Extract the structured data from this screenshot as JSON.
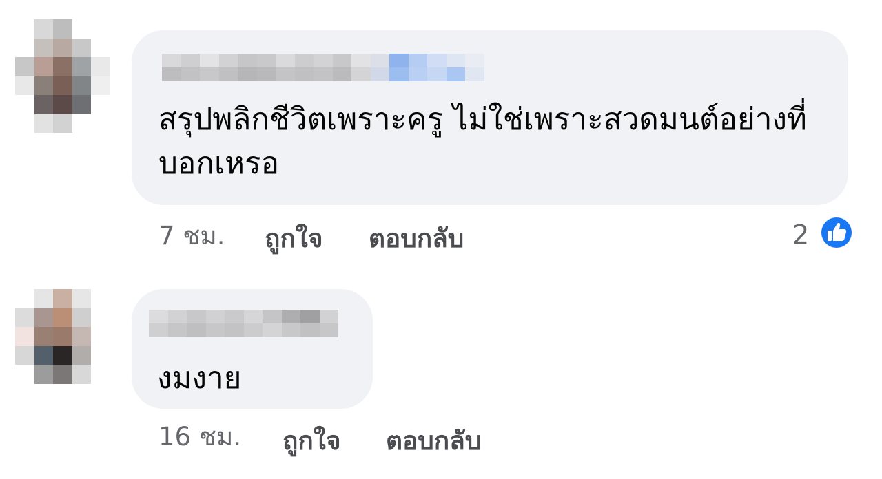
{
  "comments": [
    {
      "text": "สรุปพลิกชีวิตเพราะครู ไม่ใช่เพราะสวดมนต์อย่างที่บอกเหรอ",
      "time": "7 ชม.",
      "like_label": "ถูกใจ",
      "reply_label": "ตอบกลับ",
      "reaction_count": "2",
      "reaction_icon": "thumbs-up-icon",
      "reaction_color": "#1877f2"
    },
    {
      "text": "งมงาย",
      "time": "16 ชม.",
      "like_label": "ถูกใจ",
      "reply_label": "ตอบกลับ"
    }
  ]
}
